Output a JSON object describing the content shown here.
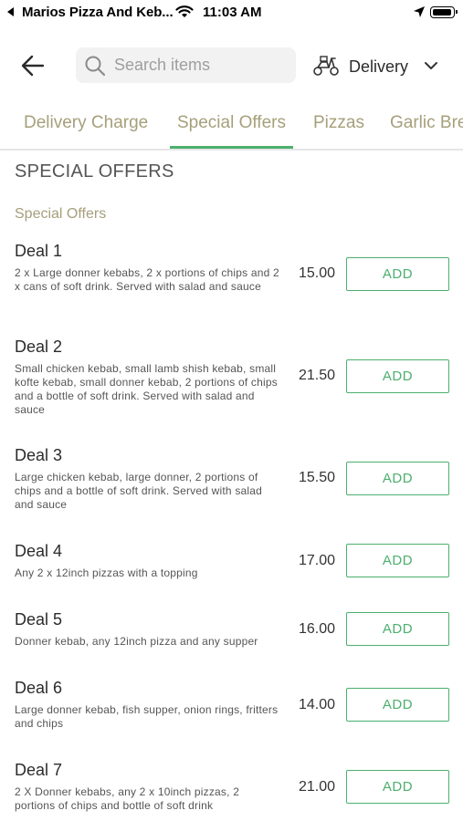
{
  "status_bar": {
    "app_name": "Marios Pizza And Keb...",
    "time": "11:03 AM"
  },
  "header": {
    "search_placeholder": "Search items",
    "delivery_label": "Delivery"
  },
  "tabs": [
    {
      "label": "Delivery Charge",
      "active": false
    },
    {
      "label": "Special Offers",
      "active": true
    },
    {
      "label": "Pizzas",
      "active": false
    },
    {
      "label": "Garlic Bre",
      "active": false
    }
  ],
  "section": {
    "title": "SPECIAL OFFERS",
    "subtitle": "Special Offers"
  },
  "items": [
    {
      "name": "Deal 1",
      "description": "2 x Large donner kebabs, 2 x portions of chips and 2 x cans of soft drink. Served with salad and sauce",
      "price": "15.00",
      "button": "ADD"
    },
    {
      "name": "Deal 2",
      "description": "Small chicken kebab, small lamb shish kebab, small kofte kebab, small donner kebab, 2 portions of chips and a bottle of soft drink. Served with salad and sauce",
      "price": "21.50",
      "button": "ADD"
    },
    {
      "name": "Deal 3",
      "description": "Large chicken kebab, large donner, 2 portions of chips and a bottle of soft drink. Served with salad and sauce",
      "price": "15.50",
      "button": "ADD"
    },
    {
      "name": "Deal 4",
      "description": "Any 2 x 12inch pizzas with a topping",
      "price": "17.00",
      "button": "ADD"
    },
    {
      "name": "Deal 5",
      "description": "Donner kebab, any 12inch pizza and any supper",
      "price": "16.00",
      "button": "ADD"
    },
    {
      "name": "Deal 6",
      "description": "Large donner kebab, fish supper, onion rings, fritters and chips",
      "price": "14.00",
      "button": "ADD"
    },
    {
      "name": "Deal 7",
      "description": "2 X Donner kebabs, any 2 x 10inch pizzas, 2 portions of chips and bottle of soft drink",
      "price": "21.00",
      "button": "ADD"
    }
  ],
  "colors": {
    "accent_green": "#4caf6e",
    "tab_text": "#a69f7b",
    "search_bg": "#f2f2f2"
  }
}
